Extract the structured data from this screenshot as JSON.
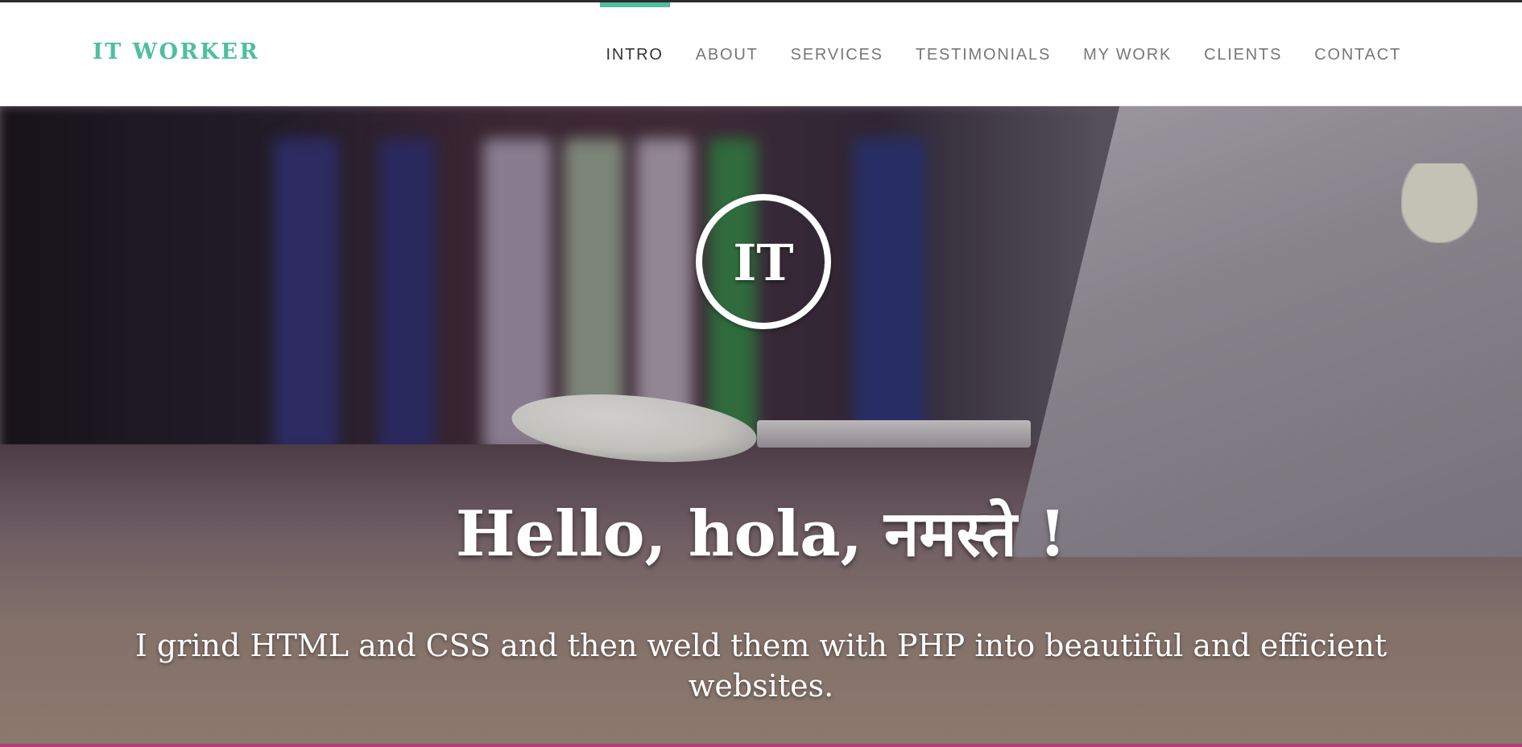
{
  "brand": {
    "name": "IT WORKER"
  },
  "nav": {
    "items": [
      {
        "label": "INTRO",
        "active": true
      },
      {
        "label": "ABOUT",
        "active": false
      },
      {
        "label": "SERVICES",
        "active": false
      },
      {
        "label": "TESTIMONIALS",
        "active": false
      },
      {
        "label": "MY WORK",
        "active": false
      },
      {
        "label": "CLIENTS",
        "active": false
      },
      {
        "label": "CONTACT",
        "active": false
      }
    ]
  },
  "hero": {
    "logo_text": "IT",
    "title": "Hello, hola, नमस्ते !",
    "subtitle": "I grind HTML and CSS and then weld them with PHP into beautiful and efficient websites."
  },
  "colors": {
    "accent": "#4dbf9f",
    "nav_text": "#777777",
    "nav_active_text": "#333333",
    "hero_text": "#ffffff"
  }
}
